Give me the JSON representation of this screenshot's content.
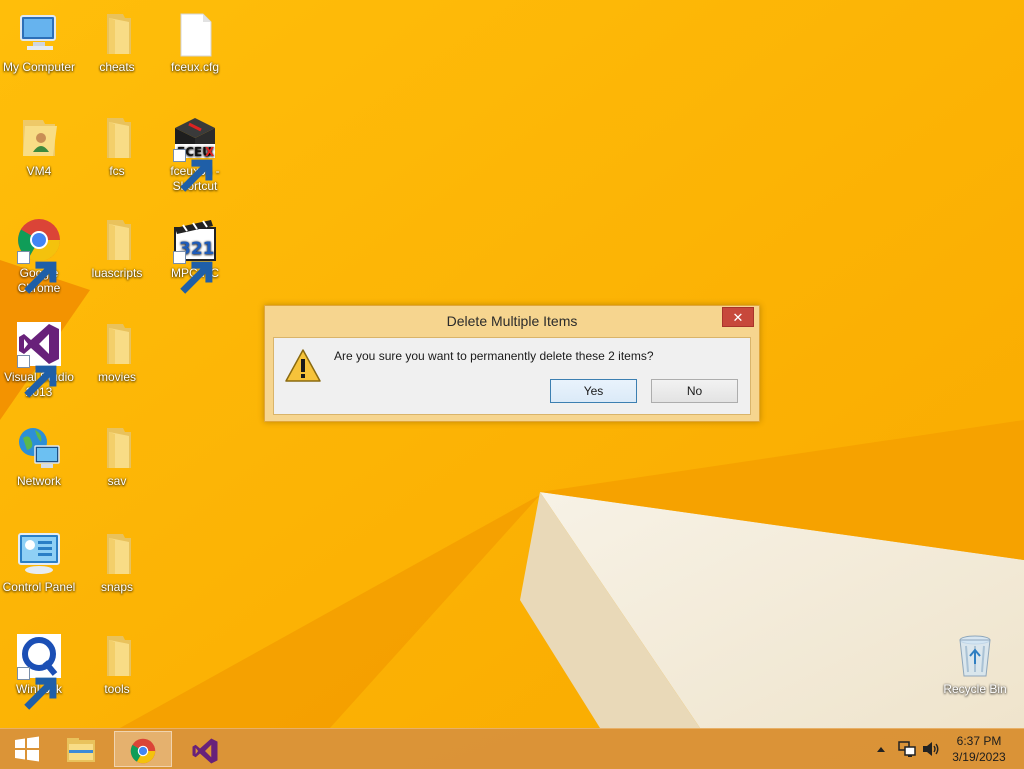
{
  "desktop": {
    "icons": [
      {
        "label": "My Computer",
        "icon": "computer-icon"
      },
      {
        "label": "cheats",
        "icon": "folder-icon"
      },
      {
        "label": "fceux.cfg",
        "icon": "file-icon"
      },
      {
        "label": "VM4",
        "icon": "user-folder-icon"
      },
      {
        "label": "fcs",
        "icon": "folder-icon"
      },
      {
        "label": "fceux64 - Shortcut",
        "icon": "fceux-icon"
      },
      {
        "label": "Google Chrome",
        "icon": "chrome-icon"
      },
      {
        "label": "luascripts",
        "icon": "folder-icon"
      },
      {
        "label": "MPC-HC",
        "icon": "mpc-hc-icon"
      },
      {
        "label": "Visual Studio 2013",
        "icon": "visual-studio-icon"
      },
      {
        "label": "movies",
        "icon": "folder-icon"
      },
      {
        "label": "Network",
        "icon": "network-icon"
      },
      {
        "label": "sav",
        "icon": "folder-icon"
      },
      {
        "label": "Control Panel",
        "icon": "control-panel-icon"
      },
      {
        "label": "snaps",
        "icon": "folder-icon"
      },
      {
        "label": "WinLock",
        "icon": "winlock-icon"
      },
      {
        "label": "tools",
        "icon": "folder-icon"
      },
      {
        "label": "Recycle Bin",
        "icon": "recycle-bin-icon"
      }
    ]
  },
  "dialog": {
    "title": "Delete Multiple Items",
    "close_label": "✕",
    "message": "Are you sure you want to permanently delete these 2 items?",
    "yes_label": "Yes",
    "no_label": "No"
  },
  "taskbar": {
    "items": [
      "start-icon",
      "file-explorer-icon",
      "chrome-icon",
      "visual-studio-icon"
    ],
    "clock_time": "6:37 PM",
    "clock_date": "3/19/2023"
  },
  "colors": {
    "wallpaper": "#fdb000",
    "dialog_frame": "#f6d58f",
    "close_button": "#c7483b",
    "taskbar": "#d8923c"
  }
}
